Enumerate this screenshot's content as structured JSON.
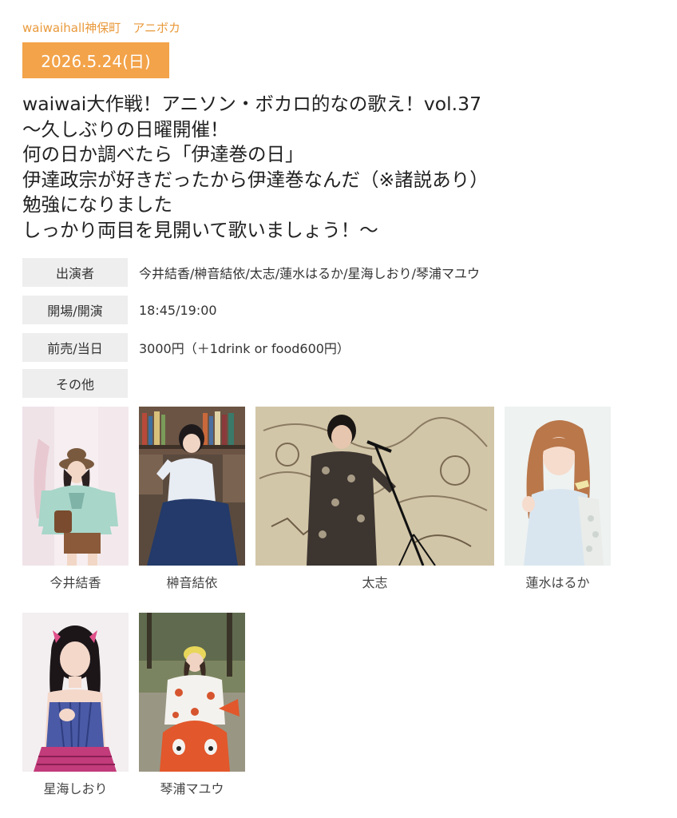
{
  "venue_line": "waiwaihall神保町　アニボカ",
  "date": "2026.5.24(日)",
  "title_lines": [
    "waiwai大作戦！アニソン・ボカロ的なの歌え！vol.37",
    "～久しぶりの日曜開催！",
    "何の日か調べたら「伊達巻の日」",
    "伊達政宗が好きだったから伊達巻なんだ（※諸説あり）",
    "勉強になりました",
    "しっかり両目を見開いて歌いましょう！～"
  ],
  "info": [
    {
      "label": "出演者",
      "value": "今井結香/榊音結依/太志/蓮水はるか/星海しおり/琴浦マユウ"
    },
    {
      "label": "開場/開演",
      "value": "18:45/19:00"
    },
    {
      "label": "前売/当日",
      "value": "3000円（＋1drink or food600円）"
    },
    {
      "label": "その他",
      "value": ""
    }
  ],
  "performers": [
    {
      "name": "今井結香"
    },
    {
      "name": "榊音結依"
    },
    {
      "name": "太志"
    },
    {
      "name": "蓮水はるか"
    },
    {
      "name": "星海しおり"
    },
    {
      "name": "琴浦マユウ"
    }
  ],
  "colors": {
    "accent": "#f3a34a",
    "venue_text": "#e99a3c",
    "label_bg": "#eeeeee"
  }
}
